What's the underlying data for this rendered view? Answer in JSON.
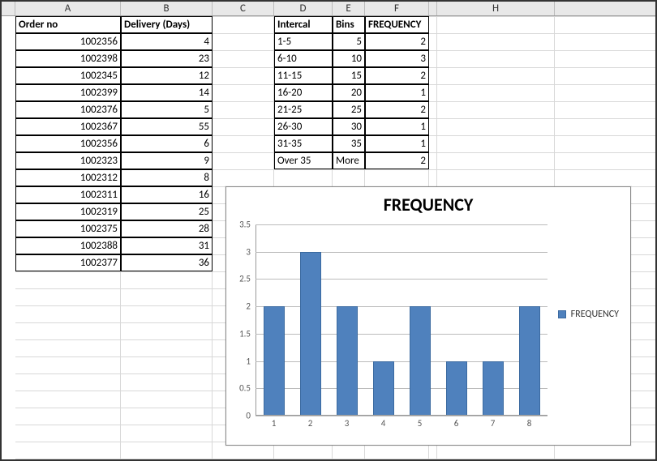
{
  "columns": [
    "A",
    "B",
    "C",
    "D",
    "E",
    "F",
    "",
    "H"
  ],
  "headers": {
    "A": "Order no",
    "B": "Delivery (Days)",
    "D": "Intercal",
    "E": "Bins",
    "F": "FREQUENCY"
  },
  "orders": [
    {
      "no": "1002356",
      "days": "4"
    },
    {
      "no": "1002398",
      "days": "23"
    },
    {
      "no": "1002345",
      "days": "12"
    },
    {
      "no": "1002399",
      "days": "14"
    },
    {
      "no": "1002376",
      "days": "5"
    },
    {
      "no": "1002367",
      "days": "55"
    },
    {
      "no": "1002356",
      "days": "6"
    },
    {
      "no": "1002323",
      "days": "9"
    },
    {
      "no": "1002312",
      "days": "8"
    },
    {
      "no": "1002311",
      "days": "16"
    },
    {
      "no": "1002319",
      "days": "25"
    },
    {
      "no": "1002375",
      "days": "28"
    },
    {
      "no": "1002388",
      "days": "31"
    },
    {
      "no": "1002377",
      "days": "36"
    }
  ],
  "frequency_table": [
    {
      "interval": "1-5",
      "bin": "5",
      "freq": "2"
    },
    {
      "interval": "6-10",
      "bin": "10",
      "freq": "3"
    },
    {
      "interval": "11-15",
      "bin": "15",
      "freq": "2"
    },
    {
      "interval": "16-20",
      "bin": "20",
      "freq": "1"
    },
    {
      "interval": "21-25",
      "bin": "25",
      "freq": "2"
    },
    {
      "interval": "26-30",
      "bin": "30",
      "freq": "1"
    },
    {
      "interval": "31-35",
      "bin": "35",
      "freq": "1"
    },
    {
      "interval": "Over 35",
      "bin": "More",
      "freq": "2"
    }
  ],
  "chart": {
    "title": "FREQUENCY",
    "legend": "FREQUENCY"
  },
  "chart_data": {
    "type": "bar",
    "categories": [
      "1",
      "2",
      "3",
      "4",
      "5",
      "6",
      "7",
      "8"
    ],
    "values": [
      2,
      3,
      2,
      1,
      2,
      1,
      1,
      2
    ],
    "title": "FREQUENCY",
    "xlabel": "",
    "ylabel": "",
    "ylim": [
      0,
      3.5
    ],
    "yticks": [
      0,
      0.5,
      1,
      1.5,
      2,
      2.5,
      3,
      3.5
    ],
    "series_name": "FREQUENCY"
  }
}
